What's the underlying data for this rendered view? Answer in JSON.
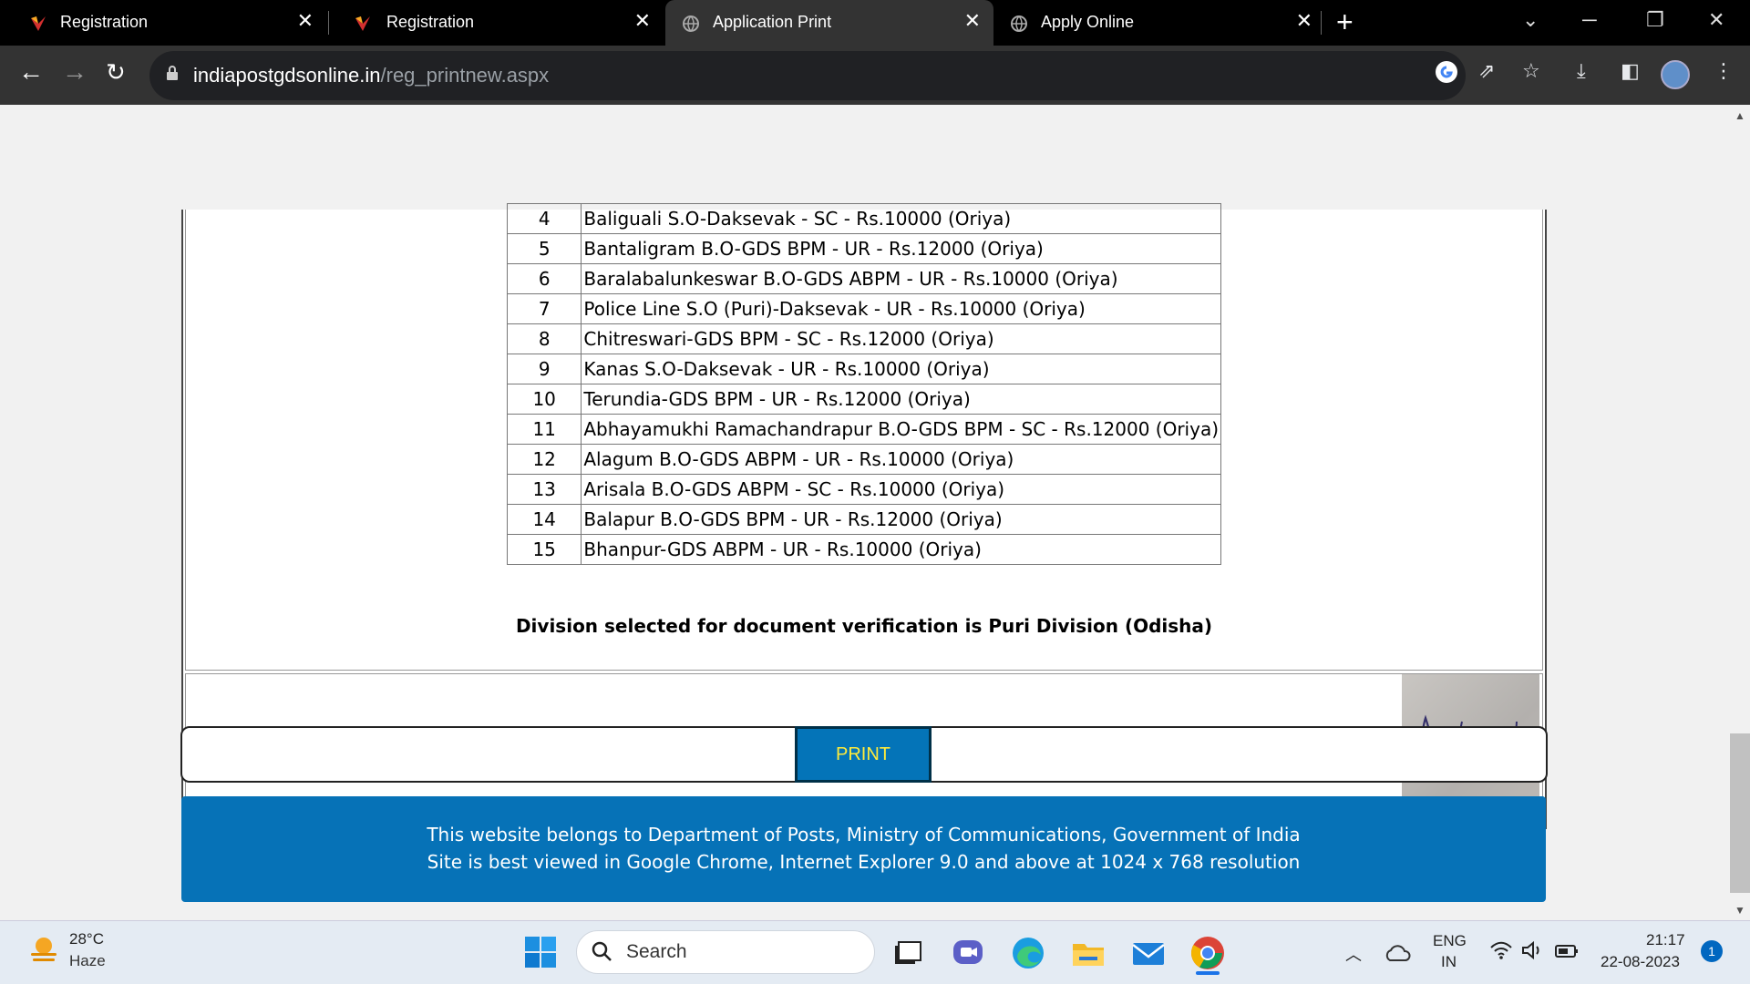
{
  "browser": {
    "tabs": [
      {
        "title": "Registration",
        "favicon": "india-post-logo-icon",
        "active": false
      },
      {
        "title": "Registration",
        "favicon": "india-post-logo-icon",
        "active": false
      },
      {
        "title": "Application Print",
        "favicon": "globe-icon",
        "active": true
      },
      {
        "title": "Apply Online",
        "favicon": "globe-icon",
        "active": false
      }
    ],
    "url_host": "indiapostgdsonline.in",
    "url_path": "/reg_printnew.aspx"
  },
  "page": {
    "posts_table": [
      {
        "sno": "4",
        "post": "Baliguali S.O-Daksevak - SC - Rs.10000 (Oriya)"
      },
      {
        "sno": "5",
        "post": "Bantaligram B.O-GDS BPM - UR - Rs.12000 (Oriya)"
      },
      {
        "sno": "6",
        "post": "Baralabalunkeswar B.O-GDS ABPM - UR - Rs.10000 (Oriya)"
      },
      {
        "sno": "7",
        "post": "Police Line S.O (Puri)-Daksevak - UR - Rs.10000 (Oriya)"
      },
      {
        "sno": "8",
        "post": "Chitreswari-GDS BPM - SC - Rs.12000 (Oriya)"
      },
      {
        "sno": "9",
        "post": "Kanas S.O-Daksevak - UR - Rs.10000 (Oriya)"
      },
      {
        "sno": "10",
        "post": "Terundia-GDS BPM - UR - Rs.12000 (Oriya)"
      },
      {
        "sno": "11",
        "post": "Abhayamukhi Ramachandrapur B.O-GDS BPM - SC - Rs.12000 (Oriya)"
      },
      {
        "sno": "12",
        "post": "Alagum B.O-GDS ABPM - UR - Rs.10000 (Oriya)"
      },
      {
        "sno": "13",
        "post": "Arisala B.O-GDS ABPM - SC - Rs.10000 (Oriya)"
      },
      {
        "sno": "14",
        "post": "Balapur B.O-GDS BPM - UR - Rs.12000 (Oriya)"
      },
      {
        "sno": "15",
        "post": "Bhanpur-GDS ABPM - UR - Rs.10000 (Oriya)"
      }
    ],
    "division_note": "Division selected for document verification is Puri Division (Odisha)",
    "signature_text": "Banita sethi",
    "print_label": "PRINT",
    "footer_line1": "This website belongs to Department of Posts, Ministry of Communications, Government of India",
    "footer_line2": "Site is best viewed in Google Chrome, Internet Explorer 9.0 and above at 1024 x 768 resolution"
  },
  "taskbar": {
    "temperature": "28°C",
    "weather": "Haze",
    "search_placeholder": "Search",
    "lang_line1": "ENG",
    "lang_line2": "IN",
    "time": "21:17",
    "date": "22-08-2023",
    "notification_count": "1"
  },
  "colors": {
    "footer_bg": "#0672b7",
    "print_bg": "#0474b8",
    "print_text": "#ffeb3b"
  }
}
